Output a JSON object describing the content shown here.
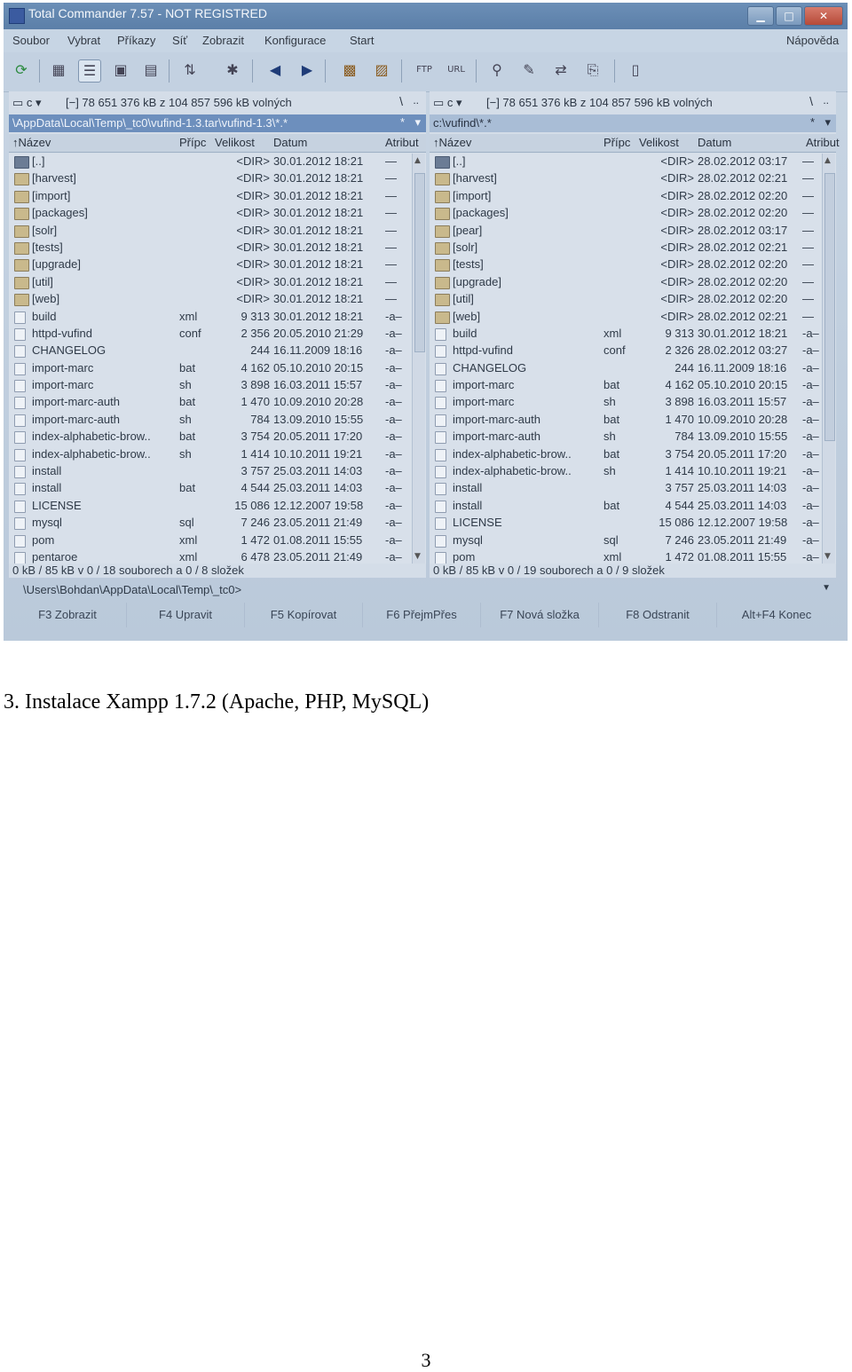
{
  "window": {
    "title": "Total Commander 7.57 - NOT REGISTRED",
    "help_menu": "Nápověda",
    "buttons": {
      "minimize": "▁",
      "maximize": "□",
      "close": "✕"
    }
  },
  "menu": [
    "Soubor",
    "Vybrat",
    "Příkazy",
    "Síť",
    "Zobrazit",
    "Konfigurace",
    "Start"
  ],
  "left_panel": {
    "drive": "c",
    "free_space": "[−]  78 651 376 kB z 104 857 596 kB volných",
    "root": "\\",
    "up": "..",
    "path": "\\AppData\\Local\\Temp\\_tc0\\vufind-1.3.tar\\vufind-1.3\\*.*",
    "path_hist": "*",
    "columns": {
      "name": "↑Název",
      "ext": "Přípc",
      "size": "Velikost",
      "date": "Datum",
      "attr": "Atribut"
    },
    "rows": [
      {
        "icon": "up",
        "name": "[..]",
        "ext": "",
        "size": "<DIR>",
        "date": "30.01.2012 18:21",
        "attr": "—"
      },
      {
        "icon": "folder",
        "name": "[harvest]",
        "ext": "",
        "size": "<DIR>",
        "date": "30.01.2012 18:21",
        "attr": "—"
      },
      {
        "icon": "folder",
        "name": "[import]",
        "ext": "",
        "size": "<DIR>",
        "date": "30.01.2012 18:21",
        "attr": "—"
      },
      {
        "icon": "folder",
        "name": "[packages]",
        "ext": "",
        "size": "<DIR>",
        "date": "30.01.2012 18:21",
        "attr": "—"
      },
      {
        "icon": "folder",
        "name": "[solr]",
        "ext": "",
        "size": "<DIR>",
        "date": "30.01.2012 18:21",
        "attr": "—"
      },
      {
        "icon": "folder",
        "name": "[tests]",
        "ext": "",
        "size": "<DIR>",
        "date": "30.01.2012 18:21",
        "attr": "—"
      },
      {
        "icon": "folder",
        "name": "[upgrade]",
        "ext": "",
        "size": "<DIR>",
        "date": "30.01.2012 18:21",
        "attr": "—"
      },
      {
        "icon": "folder",
        "name": "[util]",
        "ext": "",
        "size": "<DIR>",
        "date": "30.01.2012 18:21",
        "attr": "—"
      },
      {
        "icon": "folder",
        "name": "[web]",
        "ext": "",
        "size": "<DIR>",
        "date": "30.01.2012 18:21",
        "attr": "—"
      },
      {
        "icon": "file",
        "name": "build",
        "ext": "xml",
        "size": "9 313",
        "date": "30.01.2012 18:21",
        "attr": "-a–"
      },
      {
        "icon": "file",
        "name": "httpd-vufind",
        "ext": "conf",
        "size": "2 356",
        "date": "20.05.2010 21:29",
        "attr": "-a–"
      },
      {
        "icon": "file",
        "name": "CHANGELOG",
        "ext": "",
        "size": "244",
        "date": "16.11.2009 18:16",
        "attr": "-a–"
      },
      {
        "icon": "file",
        "name": "import-marc",
        "ext": "bat",
        "size": "4 162",
        "date": "05.10.2010 20:15",
        "attr": "-a–"
      },
      {
        "icon": "file",
        "name": "import-marc",
        "ext": "sh",
        "size": "3 898",
        "date": "16.03.2011 15:57",
        "attr": "-a–"
      },
      {
        "icon": "file",
        "name": "import-marc-auth",
        "ext": "bat",
        "size": "1 470",
        "date": "10.09.2010 20:28",
        "attr": "-a–"
      },
      {
        "icon": "file",
        "name": "import-marc-auth",
        "ext": "sh",
        "size": "784",
        "date": "13.09.2010 15:55",
        "attr": "-a–"
      },
      {
        "icon": "file",
        "name": "index-alphabetic-brow..",
        "ext": "bat",
        "size": "3 754",
        "date": "20.05.2011 17:20",
        "attr": "-a–"
      },
      {
        "icon": "file",
        "name": "index-alphabetic-brow..",
        "ext": "sh",
        "size": "1 414",
        "date": "10.10.2011 19:21",
        "attr": "-a–"
      },
      {
        "icon": "file",
        "name": "install",
        "ext": "",
        "size": "3 757",
        "date": "25.03.2011 14:03",
        "attr": "-a–"
      },
      {
        "icon": "file",
        "name": "install",
        "ext": "bat",
        "size": "4 544",
        "date": "25.03.2011 14:03",
        "attr": "-a–"
      },
      {
        "icon": "file",
        "name": "LICENSE",
        "ext": "",
        "size": "15 086",
        "date": "12.12.2007 19:58",
        "attr": "-a–"
      },
      {
        "icon": "file",
        "name": "mysql",
        "ext": "sql",
        "size": "7 246",
        "date": "23.05.2011 21:49",
        "attr": "-a–"
      },
      {
        "icon": "file",
        "name": "pom",
        "ext": "xml",
        "size": "1 472",
        "date": "01.08.2011 15:55",
        "attr": "-a–"
      },
      {
        "icon": "file",
        "name": "pentaroe",
        "ext": "xml",
        "size": "6 478",
        "date": "23.05.2011 21:49",
        "attr": "-a–"
      }
    ],
    "status": "0 kB / 85 kB v 0 / 18 souborech a 0 / 8 složek"
  },
  "right_panel": {
    "drive": "c",
    "free_space": "[−]  78 651 376 kB z 104 857 596 kB volných",
    "root": "\\",
    "up": "..",
    "path": "c:\\vufind\\*.*",
    "path_hist": "*",
    "columns": {
      "name": "↑Název",
      "ext": "Přípc",
      "size": "Velikost",
      "date": "Datum",
      "attr": "Atribut"
    },
    "rows": [
      {
        "icon": "up",
        "name": "[..]",
        "ext": "",
        "size": "<DIR>",
        "date": "28.02.2012 03:17",
        "attr": "—"
      },
      {
        "icon": "folder",
        "name": "[harvest]",
        "ext": "",
        "size": "<DIR>",
        "date": "28.02.2012 02:21",
        "attr": "—"
      },
      {
        "icon": "folder",
        "name": "[import]",
        "ext": "",
        "size": "<DIR>",
        "date": "28.02.2012 02:20",
        "attr": "—"
      },
      {
        "icon": "folder",
        "name": "[packages]",
        "ext": "",
        "size": "<DIR>",
        "date": "28.02.2012 02:20",
        "attr": "—"
      },
      {
        "icon": "folder",
        "name": "[pear]",
        "ext": "",
        "size": "<DIR>",
        "date": "28.02.2012 03:17",
        "attr": "—"
      },
      {
        "icon": "folder",
        "name": "[solr]",
        "ext": "",
        "size": "<DIR>",
        "date": "28.02.2012 02:21",
        "attr": "—"
      },
      {
        "icon": "folder",
        "name": "[tests]",
        "ext": "",
        "size": "<DIR>",
        "date": "28.02.2012 02:20",
        "attr": "—"
      },
      {
        "icon": "folder",
        "name": "[upgrade]",
        "ext": "",
        "size": "<DIR>",
        "date": "28.02.2012 02:20",
        "attr": "—"
      },
      {
        "icon": "folder",
        "name": "[util]",
        "ext": "",
        "size": "<DIR>",
        "date": "28.02.2012 02:20",
        "attr": "—"
      },
      {
        "icon": "folder",
        "name": "[web]",
        "ext": "",
        "size": "<DIR>",
        "date": "28.02.2012 02:21",
        "attr": "—"
      },
      {
        "icon": "file",
        "name": "build",
        "ext": "xml",
        "size": "9 313",
        "date": "30.01.2012 18:21",
        "attr": "-a–"
      },
      {
        "icon": "file",
        "name": "httpd-vufind",
        "ext": "conf",
        "size": "2 326",
        "date": "28.02.2012 03:27",
        "attr": "-a–"
      },
      {
        "icon": "file",
        "name": "CHANGELOG",
        "ext": "",
        "size": "244",
        "date": "16.11.2009 18:16",
        "attr": "-a–"
      },
      {
        "icon": "file",
        "name": "import-marc",
        "ext": "bat",
        "size": "4 162",
        "date": "05.10.2010 20:15",
        "attr": "-a–"
      },
      {
        "icon": "file",
        "name": "import-marc",
        "ext": "sh",
        "size": "3 898",
        "date": "16.03.2011 15:57",
        "attr": "-a–"
      },
      {
        "icon": "file",
        "name": "import-marc-auth",
        "ext": "bat",
        "size": "1 470",
        "date": "10.09.2010 20:28",
        "attr": "-a–"
      },
      {
        "icon": "file",
        "name": "import-marc-auth",
        "ext": "sh",
        "size": "784",
        "date": "13.09.2010 15:55",
        "attr": "-a–"
      },
      {
        "icon": "file",
        "name": "index-alphabetic-brow..",
        "ext": "bat",
        "size": "3 754",
        "date": "20.05.2011 17:20",
        "attr": "-a–"
      },
      {
        "icon": "file",
        "name": "index-alphabetic-brow..",
        "ext": "sh",
        "size": "1 414",
        "date": "10.10.2011 19:21",
        "attr": "-a–"
      },
      {
        "icon": "file",
        "name": "install",
        "ext": "",
        "size": "3 757",
        "date": "25.03.2011 14:03",
        "attr": "-a–"
      },
      {
        "icon": "file",
        "name": "install",
        "ext": "bat",
        "size": "4 544",
        "date": "25.03.2011 14:03",
        "attr": "-a–"
      },
      {
        "icon": "file",
        "name": "LICENSE",
        "ext": "",
        "size": "15 086",
        "date": "12.12.2007 19:58",
        "attr": "-a–"
      },
      {
        "icon": "file",
        "name": "mysql",
        "ext": "sql",
        "size": "7 246",
        "date": "23.05.2011 21:49",
        "attr": "-a–"
      },
      {
        "icon": "file",
        "name": "pom",
        "ext": "xml",
        "size": "1 472",
        "date": "01.08.2011 15:55",
        "attr": "-a–"
      }
    ],
    "status": "0 kB / 85 kB v 0 / 19 souborech a 0 / 9 složek"
  },
  "command_line": {
    "path": "\\Users\\Bohdan\\AppData\\Local\\Temp\\_tc0>",
    "dropdown": "▼"
  },
  "function_keys": [
    "F3 Zobrazit",
    "F4 Upravit",
    "F5 Kopírovat",
    "F6 PřejmPřes",
    "F7 Nová složka",
    "F8 Odstranit",
    "Alt+F4 Konec"
  ],
  "toolbar_icons": [
    "refresh-icon",
    "brief-view-icon",
    "detailed-view-icon",
    "thumbnail-view-icon",
    "tree-view-icon",
    "sort-icon",
    "invert-selection-icon",
    "back-icon",
    "forward-icon",
    "pack-icon",
    "unpack-icon",
    "ftp-connect-icon",
    "url-connect-icon",
    "search-icon",
    "rename-icon",
    "sync-dirs-icon",
    "copy-names-icon",
    "notepad-icon"
  ],
  "caption": "3. Instalace Xampp 1.7.2 (Apache, PHP, MySQL)",
  "page_number": "3"
}
